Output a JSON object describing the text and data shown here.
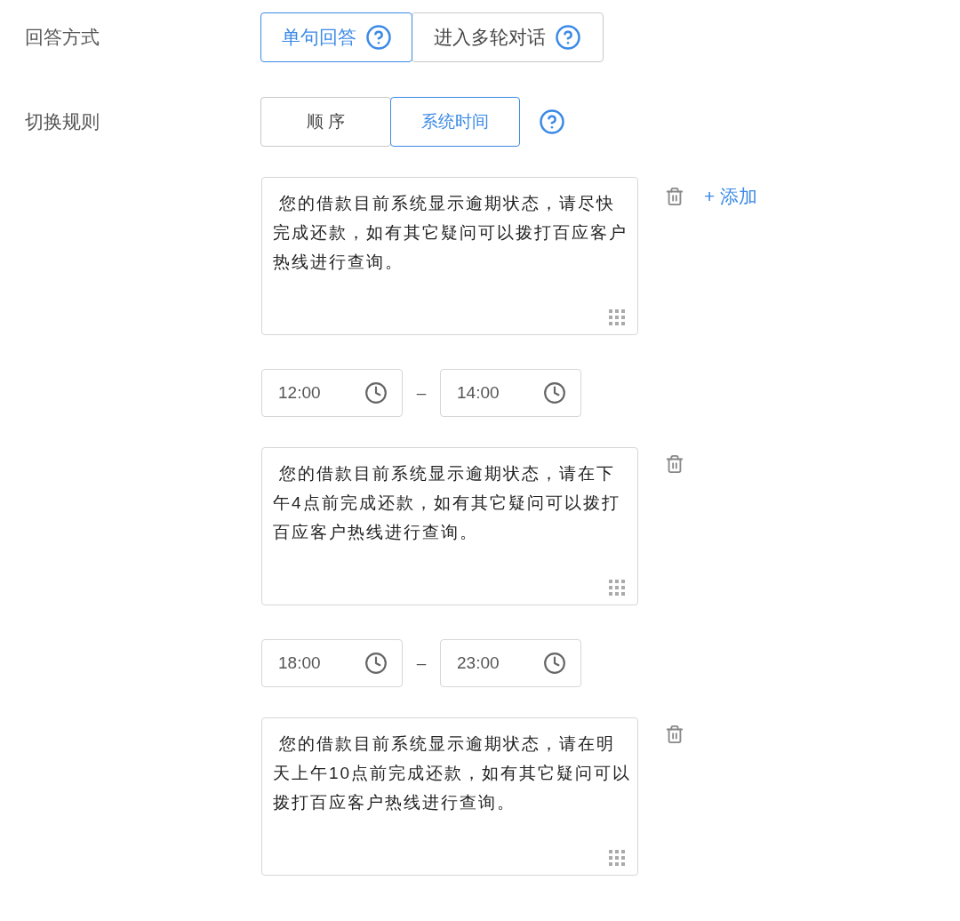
{
  "answer_mode": {
    "label": "回答方式",
    "options": [
      {
        "label": "单句回答",
        "selected": true,
        "help": true
      },
      {
        "label": "进入多轮对话",
        "selected": false,
        "help": true
      }
    ]
  },
  "switch_rule": {
    "label": "切换规则",
    "help": true,
    "options": [
      {
        "label": "顺 序",
        "selected": false
      },
      {
        "label": "系统时间",
        "selected": true
      }
    ]
  },
  "blocks": [
    {
      "kind": "message",
      "text": "您的借款目前系统显示逾期状态，请尽快完成还款，如有其它疑问可以拨打百应客户热线进行查询。",
      "add_label": "+ 添加"
    },
    {
      "kind": "time_range",
      "start": "12:00",
      "separator": "–",
      "end": "14:00"
    },
    {
      "kind": "message",
      "text": "您的借款目前系统显示逾期状态，请在下午4点前完成还款，如有其它疑问可以拨打百应客户热线进行查询。"
    },
    {
      "kind": "time_range",
      "start": "18:00",
      "separator": "–",
      "end": "23:00"
    },
    {
      "kind": "message",
      "text": "您的借款目前系统显示逾期状态，请在明天上午10点前完成还款，如有其它疑问可以拨打百应客户热线进行查询。"
    }
  ]
}
